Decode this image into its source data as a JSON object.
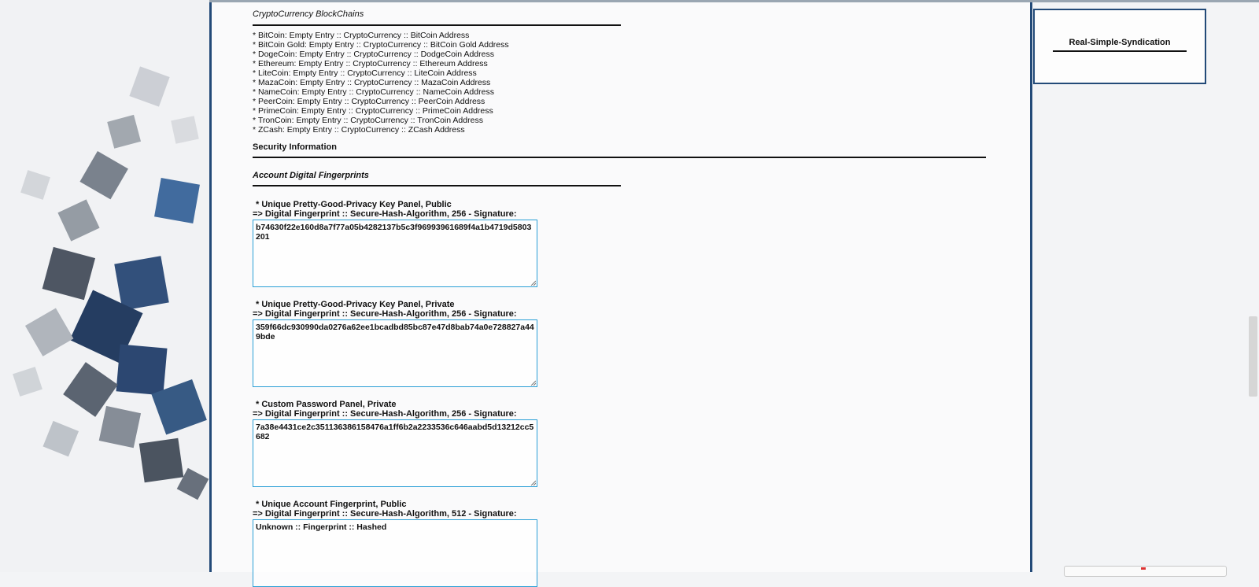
{
  "crypto": {
    "heading": "CryptoCurrency BlockChains",
    "items": [
      "* BitCoin: Empty Entry :: CryptoCurrency :: BitCoin Address",
      "* BitCoin Gold: Empty Entry :: CryptoCurrency :: BitCoin Gold Address",
      "* DogeCoin: Empty Entry :: CryptoCurrency :: DodgeCoin Address",
      "* Ethereum: Empty Entry :: CryptoCurrency :: Ethereum Address",
      "* LiteCoin: Empty Entry :: CryptoCurrency :: LiteCoin Address",
      "* MazaCoin: Empty Entry :: CryptoCurrency :: MazaCoin Address",
      "* NameCoin: Empty Entry :: CryptoCurrency :: NameCoin Address",
      "* PeerCoin: Empty Entry :: CryptoCurrency :: PeerCoin Address",
      "* PrimeCoin: Empty Entry :: CryptoCurrency :: PrimeCoin Address",
      "* TronCoin: Empty Entry :: CryptoCurrency :: TronCoin Address",
      "* ZCash: Empty Entry :: CryptoCurrency :: ZCash Address"
    ]
  },
  "security": {
    "heading": "Security Information",
    "fingerprints_heading": "Account Digital Fingerprints"
  },
  "fingerprints": [
    {
      "title": "* Unique Pretty-Good-Privacy Key Panel, Public",
      "subtitle": "=> Digital Fingerprint :: Secure-Hash-Algorithm, 256 - Signature:",
      "value": "b74630f22e160d8a7f77a05b4282137b5c3f96993961689f4a1b4719d5803201"
    },
    {
      "title": "* Unique Pretty-Good-Privacy Key Panel, Private",
      "subtitle": "=> Digital Fingerprint :: Secure-Hash-Algorithm, 256 - Signature:",
      "value": "359f66dc930990da0276a62ee1bcadbd85bc87e47d8bab74a0e728827a449bde"
    },
    {
      "title": "* Custom Password Panel, Private",
      "subtitle": "=> Digital Fingerprint :: Secure-Hash-Algorithm, 256 - Signature:",
      "value": "7a38e4431ce2c351136386158476a1ff6b2a2233536c646aabd5d13212cc5682"
    },
    {
      "title": "* Unique Account Fingerprint, Public",
      "subtitle": "=> Digital Fingerprint :: Secure-Hash-Algorithm, 512 - Signature:",
      "value": "Unknown :: Fingerprint :: Hashed"
    }
  ],
  "sidebar": {
    "rss_title": "Real-Simple-Syndication"
  },
  "colors": {
    "frame": "#234a78",
    "textarea_border": "#2a9fd6"
  }
}
